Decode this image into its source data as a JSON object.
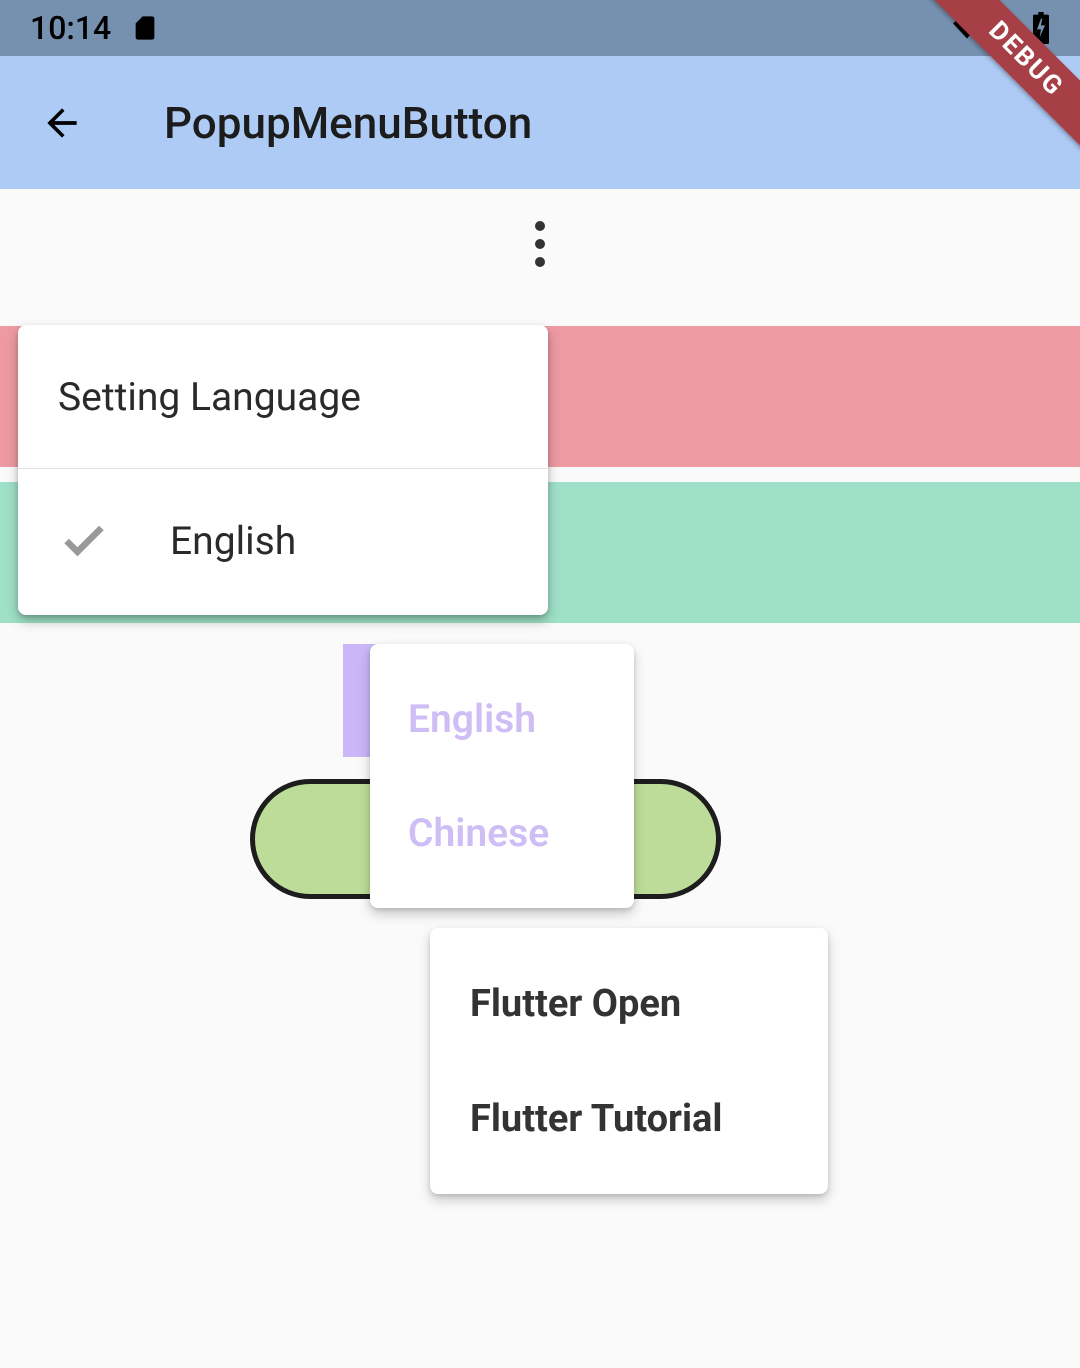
{
  "status_bar": {
    "time": "10:14"
  },
  "app_bar": {
    "title": "PopupMenuButton"
  },
  "popup1": {
    "header": "Setting Language",
    "item": "English"
  },
  "popup2": {
    "items": [
      "English",
      "Chinese"
    ]
  },
  "popup3": {
    "items": [
      "Flutter Open",
      "Flutter Tutorial"
    ]
  },
  "debug_label": "DEBUG"
}
